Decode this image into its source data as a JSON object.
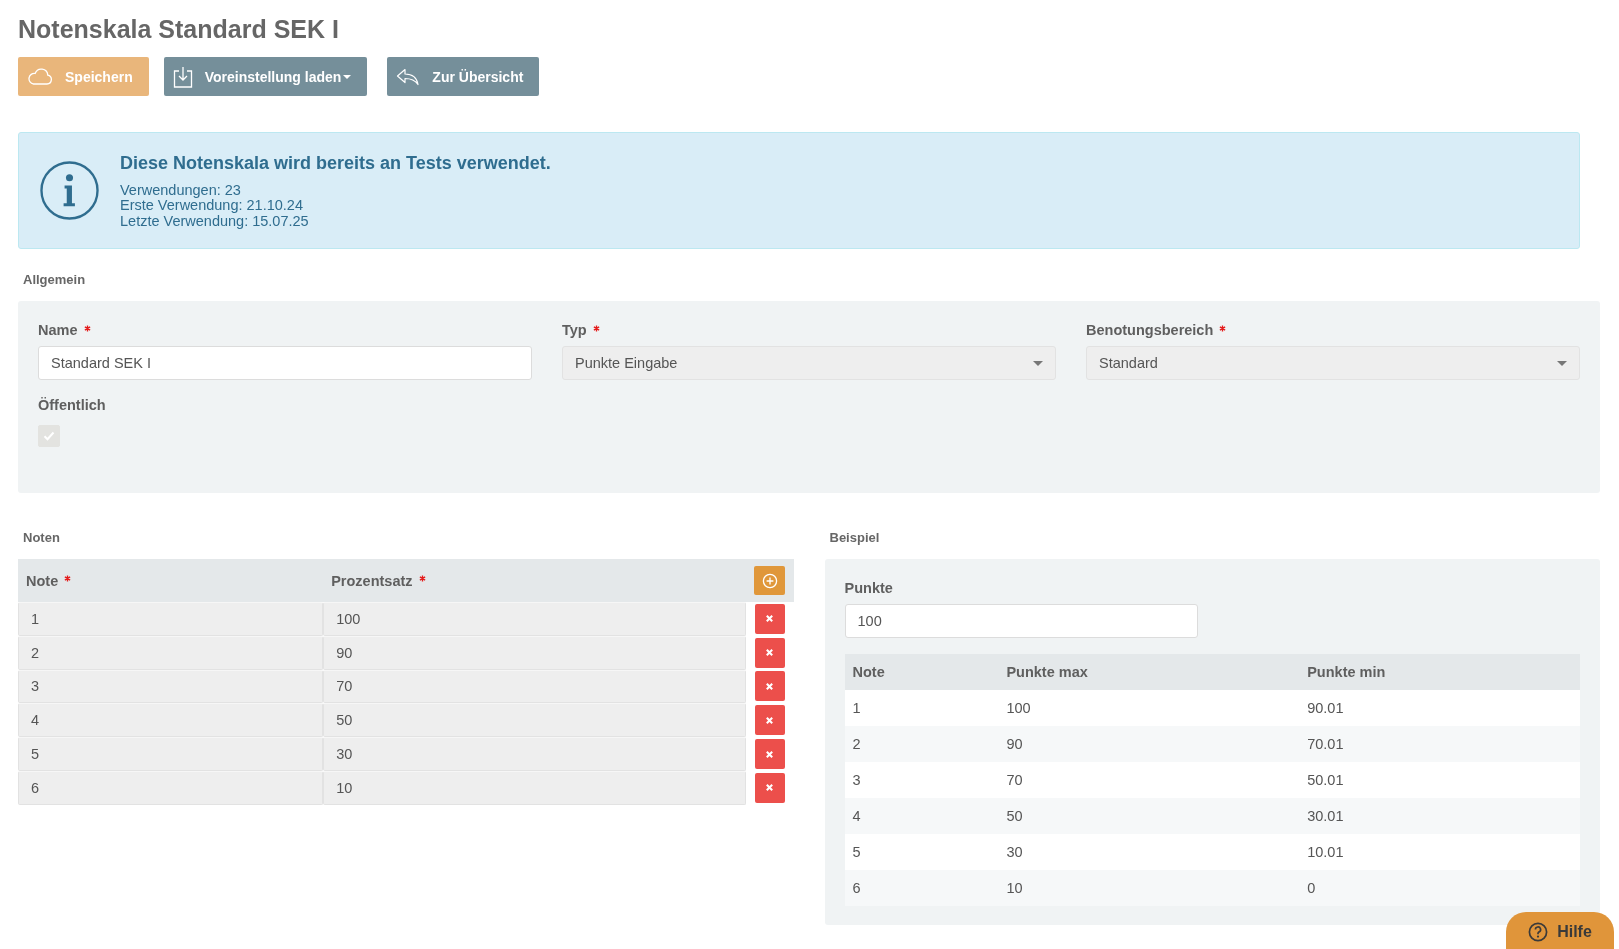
{
  "page_title": "Notenskala Standard SEK I",
  "toolbar": [
    {
      "kind": "save",
      "label": "Speichern",
      "dropdown": false
    },
    {
      "kind": "preset",
      "label": "Voreinstellung laden",
      "dropdown": true
    },
    {
      "kind": "back",
      "label": "Zur Übersicht",
      "dropdown": false
    }
  ],
  "alert": {
    "title": "Diese Notenskala wird bereits an Tests verwendet.",
    "lines": [
      "Verwendungen: 23",
      "Erste Verwendung: 21.10.24",
      "Letzte Verwendung: 15.07.25"
    ]
  },
  "general": {
    "heading": "Allgemein",
    "fields": [
      {
        "kind": "text",
        "label": "Name",
        "required": true,
        "value": "Standard SEK I"
      },
      {
        "kind": "select",
        "label": "Typ",
        "required": true,
        "value": "Punkte Eingabe"
      },
      {
        "kind": "select",
        "label": "Benotungsbereich",
        "required": true,
        "value": "Standard"
      }
    ],
    "public": {
      "label": "Öffentlich",
      "checked": true,
      "disabled": true
    }
  },
  "grades": {
    "heading": "Noten",
    "columns": [
      {
        "label": "Note",
        "required": true
      },
      {
        "label": "Prozentsatz",
        "required": true
      }
    ],
    "rows": [
      {
        "note": "1",
        "percent": "100"
      },
      {
        "note": "2",
        "percent": "90"
      },
      {
        "note": "3",
        "percent": "70"
      },
      {
        "note": "4",
        "percent": "50"
      },
      {
        "note": "5",
        "percent": "30"
      },
      {
        "note": "6",
        "percent": "10"
      }
    ]
  },
  "example": {
    "heading": "Beispiel",
    "points": {
      "label": "Punkte",
      "value": "100"
    },
    "columns": [
      "Note",
      "Punkte max",
      "Punkte min"
    ],
    "rows": [
      {
        "note": "1",
        "max": "100",
        "min": "90.01"
      },
      {
        "note": "2",
        "max": "90",
        "min": "70.01"
      },
      {
        "note": "3",
        "max": "70",
        "min": "50.01"
      },
      {
        "note": "4",
        "max": "50",
        "min": "30.01"
      },
      {
        "note": "5",
        "max": "30",
        "min": "10.01"
      },
      {
        "note": "6",
        "max": "10",
        "min": "0"
      }
    ]
  },
  "help": {
    "label": "Hilfe"
  }
}
